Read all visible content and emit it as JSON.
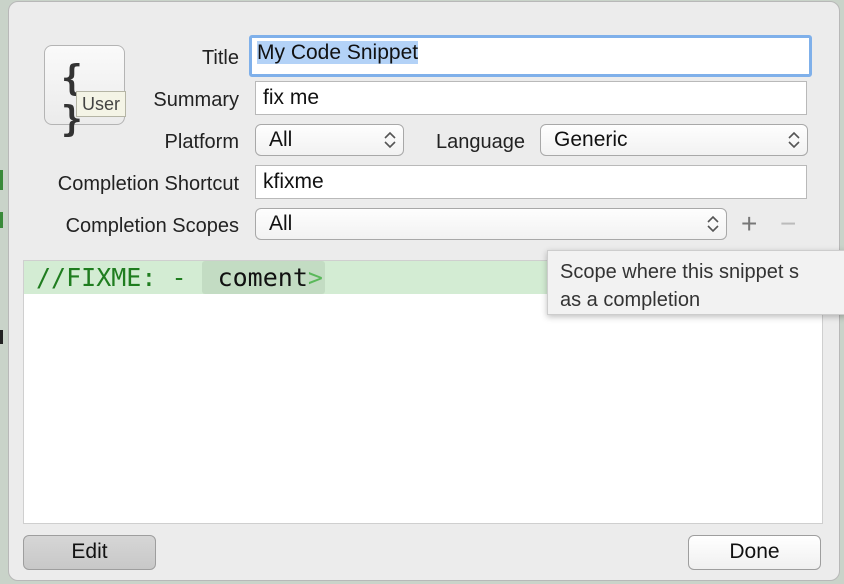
{
  "snippet": {
    "icon": "curly-braces-icon",
    "icon_tag": "User",
    "title_label": "Title",
    "title_value": "My Code Snippet",
    "summary_label": "Summary",
    "summary_value": "fix me",
    "platform_label": "Platform",
    "platform_value": "All",
    "language_label": "Language",
    "language_value": "Generic",
    "shortcut_label": "Completion Shortcut",
    "shortcut_value": "kfixme",
    "scopes_label": "Completion Scopes",
    "scopes_value": "All",
    "add_symbol": "+",
    "remove_symbol": "−"
  },
  "editor": {
    "prefix": "//FIXME: - ",
    "placeholder_token": "coment",
    "token_end": ">"
  },
  "tooltip": {
    "line1": "Scope where this snippet s",
    "line2": "as a completion"
  },
  "footer": {
    "edit_label": "Edit",
    "done_label": "Done"
  },
  "colors": {
    "accent_focus": "#7fb0ea",
    "code_comment": "#1f7d1f",
    "code_highlight": "#d3ecd3"
  }
}
